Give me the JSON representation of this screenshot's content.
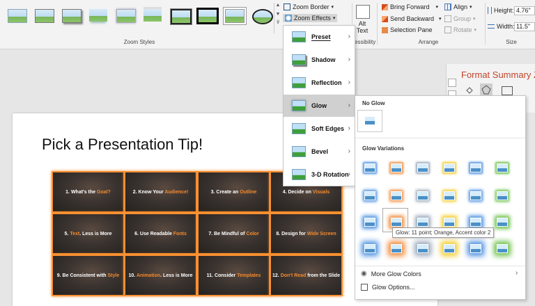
{
  "ribbon": {
    "zoom_styles_label": "Zoom Styles",
    "zoom_border": "Zoom Border",
    "zoom_effects": "Zoom Effects",
    "alt_text": "Alt Text",
    "accessibility_label": "ccessibility",
    "bring_forward": "Bring Forward",
    "send_backward": "Send Backward",
    "selection_pane": "Selection Pane",
    "align": "Align",
    "group": "Group",
    "rotate": "Rotate",
    "arrange_label": "Arrange",
    "height_label": "Height:",
    "height_value": "4.76\"",
    "width_label": "Width:",
    "width_value": "11.5\"",
    "size_label": "Size"
  },
  "slide": {
    "title": "Pick a Presentation Tip!",
    "tiles": [
      {
        "pre": "1. What's the ",
        "acc": "Goal?",
        "post": ""
      },
      {
        "pre": "2. Know Your ",
        "acc": "Audience!",
        "post": ""
      },
      {
        "pre": "3. Create an ",
        "acc": "Outline",
        "post": ""
      },
      {
        "pre": "4. Decide on ",
        "acc": "Visuals",
        "post": ""
      },
      {
        "pre": "5. ",
        "acc": "Text",
        "post": ". Less is More"
      },
      {
        "pre": "6. Use Readable ",
        "acc": "Fonts",
        "post": ""
      },
      {
        "pre": "7. Be Mindful of ",
        "acc": "Color",
        "post": ""
      },
      {
        "pre": "8. Design for ",
        "acc": "Wide Screen",
        "post": ""
      },
      {
        "pre": "9. Be Consistent with ",
        "acc": "Style",
        "post": ""
      },
      {
        "pre": "10. ",
        "acc": "Animation",
        "post": ". Less is More"
      },
      {
        "pre": "11. Consider ",
        "acc": "Templates",
        "post": ""
      },
      {
        "pre": "12. ",
        "acc": "Don't Read",
        "post": " from the Slide"
      }
    ]
  },
  "format_panel": {
    "title": "Format Summary Zoom"
  },
  "zoom_effects_menu": {
    "items": [
      "Preset",
      "Shadow",
      "Reflection",
      "Glow",
      "Soft Edges",
      "Bevel",
      "3-D Rotation"
    ]
  },
  "glow_menu": {
    "no_glow_heading": "No Glow",
    "variations_heading": "Glow Variations",
    "tooltip": "Glow: 11 point; Orange, Accent color 2",
    "more_colors": "More Glow Colors",
    "options": "Glow Options...",
    "glow_colors": [
      "#4a8fe0",
      "#f08a3a",
      "#9aa8b8",
      "#f2cc2a",
      "#4a8fe0",
      "#6cc04a"
    ]
  }
}
